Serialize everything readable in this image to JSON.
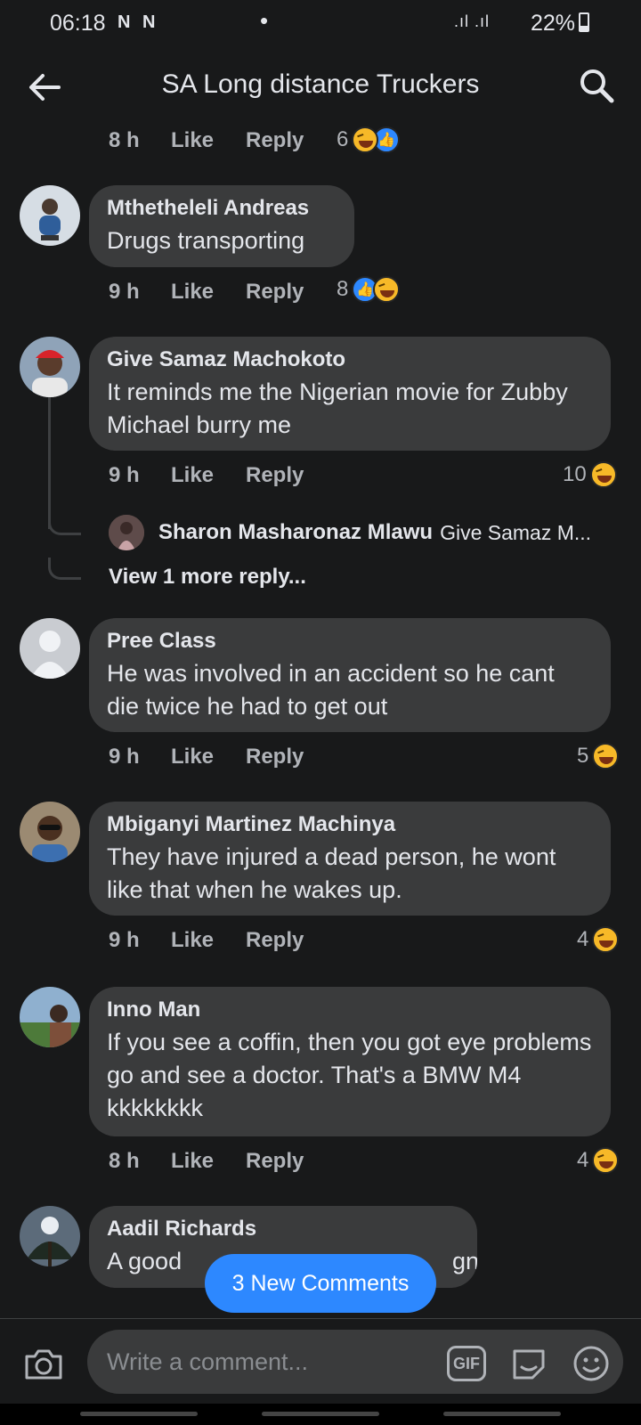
{
  "status_bar": {
    "time": "06:18",
    "notification_icons": "N N",
    "dot": "•",
    "signal": ".ıl .ıl",
    "battery": "22%"
  },
  "header": {
    "title": "SA Long distance Truckers"
  },
  "labels": {
    "like": "Like",
    "reply": "Reply"
  },
  "top_meta": {
    "time": "8 h",
    "reaction_count": "6"
  },
  "comments": [
    {
      "author": "Mthetheleli Andreas",
      "text": "Drugs transporting",
      "time": "9 h",
      "reaction_count": "8"
    },
    {
      "author": "Give Samaz Machokoto",
      "text": "It reminds me the Nigerian movie for Zubby Michael burry me",
      "time": "9 h",
      "reaction_count": "10",
      "reply_preview": {
        "author": "Sharon Masharonaz Mlawu",
        "text": "Give Samaz M..."
      },
      "view_more": "View 1 more reply..."
    },
    {
      "author": "Pree Class",
      "text": "He was involved in an accident so he cant die twice he had to get out",
      "time": "9 h",
      "reaction_count": "5"
    },
    {
      "author": "Mbiganyi Martinez Machinya",
      "text": "They have injured a dead person, he wont like that when he wakes up.",
      "time": "9 h",
      "reaction_count": "4"
    },
    {
      "author": "Inno Man",
      "text": "If you see a coffin, then you got eye problems go and see a doctor. That's a BMW M4 kkkkkkkk",
      "time": "8 h",
      "reaction_count": "4"
    },
    {
      "author": "Aadil Richards",
      "text": "A good",
      "text_tail": "gn"
    }
  ],
  "new_comments_button": "3 New Comments",
  "composer": {
    "placeholder": "Write a comment...",
    "gif_label": "GIF"
  },
  "colors": {
    "background": "#18191a",
    "bubble": "#3a3b3c",
    "accent": "#2d88ff",
    "muted_text": "#b0b3b8"
  }
}
